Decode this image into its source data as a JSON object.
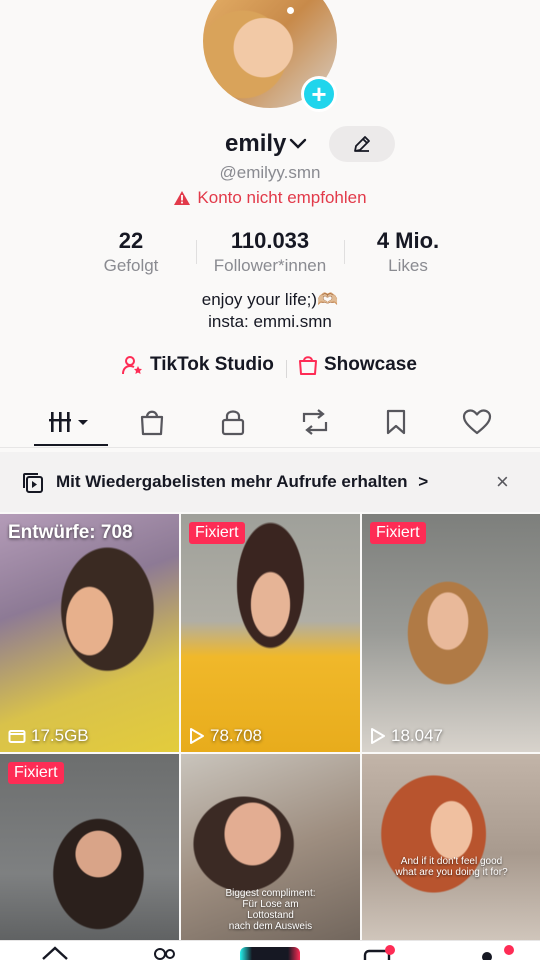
{
  "profile": {
    "username": "emily",
    "handle": "@emilyy.smn",
    "warning": "Konto nicht empfohlen"
  },
  "stats": [
    {
      "value": "22",
      "label": "Gefolgt"
    },
    {
      "value": "110.033",
      "label": "Follower*innen"
    },
    {
      "value": "4 Mio.",
      "label": "Likes"
    }
  ],
  "bio": {
    "line1": "enjoy your life;)🫶🏼",
    "line2": "insta: emmi.smn"
  },
  "links": {
    "studio": "TikTok Studio",
    "showcase": "Showcase"
  },
  "tabs": [
    "videos-icon",
    "shop-icon",
    "lock-icon",
    "repost-icon",
    "bookmark-icon",
    "heart-icon"
  ],
  "banner": {
    "text": "Mit Wiedergabelisten mehr Aufrufe erhalten",
    "chevron": ">",
    "close": "×"
  },
  "grid": {
    "drafts_label": "Entwürfe: 708",
    "pinned_label": "Fixiert",
    "items": [
      {
        "views": "17.5GB"
      },
      {
        "views": "78.708"
      },
      {
        "views": "18.047"
      }
    ],
    "caption1": "Biggest compliment:\nFür Lose am\nLottostand\nnach dem Ausweis",
    "caption2": "And if it don't feel good\nwhat are you doing it for?"
  },
  "colors": {
    "accent": "#fe2c55",
    "add": "#20d5ec",
    "warning": "#e23a4a"
  }
}
